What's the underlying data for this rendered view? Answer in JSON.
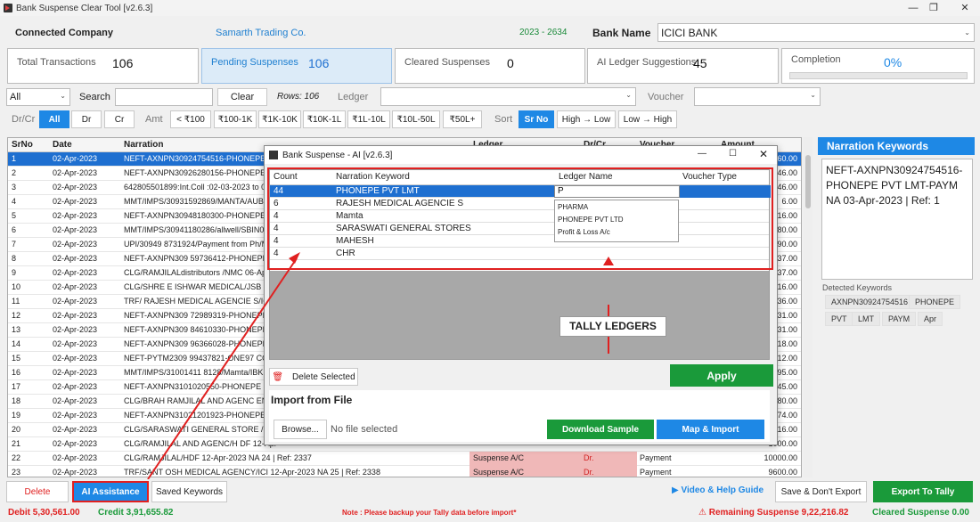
{
  "window": {
    "title": "Bank Suspense Clear Tool [v2.6.3]"
  },
  "header": {
    "company_label": "Connected Company",
    "company_value": "Samarth Trading Co.",
    "fy": "2023 - 2634",
    "bank_label": "Bank Name",
    "bank_value": "ICICI BANK"
  },
  "stats": [
    {
      "label": "Total Transactions",
      "value": "106"
    },
    {
      "label": "Pending Suspenses",
      "value": "106"
    },
    {
      "label": "Cleared Suspenses",
      "value": "0"
    },
    {
      "label": "AI Ledger Suggestions",
      "value": "45"
    },
    {
      "label": "Completion",
      "value": "0%"
    }
  ],
  "filters": {
    "all_select": "All",
    "search_label": "Search",
    "clear_label": "Clear",
    "rows_text": "Rows: 106",
    "ledger_label": "Ledger",
    "voucher_label": "Voucher",
    "drcr_label": "Dr/Cr",
    "drcr": [
      "All",
      "Dr",
      "Cr"
    ],
    "amt_label": "Amt",
    "amt": [
      "< ₹100",
      "₹100-1K",
      "₹1K-10K",
      "₹10K-1L",
      "₹1L-10L",
      "₹10L-50L",
      "₹50L+"
    ],
    "sort_label": "Sort",
    "sort": [
      "Sr No",
      "High → Low",
      "Low → High"
    ]
  },
  "grid": {
    "headers": [
      "SrNo",
      "Date",
      "Narration",
      "Ledger",
      "Dr/Cr",
      "Voucher",
      "Amount"
    ],
    "rows": [
      {
        "sr": "1",
        "date": "02-Apr-2023",
        "narr": "NEFT-AXNPN30924754516-PHONEPE PVT",
        "ledger": "",
        "drcr": "",
        "voucher": "",
        "amt": "760.00"
      },
      {
        "sr": "2",
        "date": "02-Apr-2023",
        "narr": "NEFT-AXNPN30926280156-PHONEPE PVT",
        "ledger": "",
        "drcr": "",
        "voucher": "",
        "amt": "4146.00"
      },
      {
        "sr": "3",
        "date": "02-Apr-2023",
        "narr": "642805501899:Int.Coll :02-03-2023 to 02-0",
        "ledger": "",
        "drcr": "",
        "voucher": "",
        "amt": "146.00"
      },
      {
        "sr": "4",
        "date": "02-Apr-2023",
        "narr": "MMT/IMPS/30931592869/MANTA/AUBL0",
        "ledger": "",
        "drcr": "",
        "voucher": "",
        "amt": "6.00"
      },
      {
        "sr": "5",
        "date": "02-Apr-2023",
        "narr": "NEFT-AXNPN30948180300-PHONEPE PVT",
        "ledger": "",
        "drcr": "",
        "voucher": "",
        "amt": "1116.00"
      },
      {
        "sr": "6",
        "date": "02-Apr-2023",
        "narr": "MMT/IMPS/30941180286/allwell/SBIN001",
        "ledger": "",
        "drcr": "",
        "voucher": "",
        "amt": "780.00"
      },
      {
        "sr": "7",
        "date": "02-Apr-2023",
        "narr": "UPI/30949 8731924/Payment from Ph/MA",
        "ledger": "",
        "drcr": "",
        "voucher": "",
        "amt": "1190.00"
      },
      {
        "sr": "8",
        "date": "02-Apr-2023",
        "narr": "NEFT-AXNPN309 59736412-PHONEPE PVT",
        "ledger": "",
        "drcr": "",
        "voucher": "",
        "amt": "437.00"
      },
      {
        "sr": "9",
        "date": "02-Apr-2023",
        "narr": "CLG/RAMJILALdistributors /NMC 06-Apr-2",
        "ledger": "",
        "drcr": "",
        "voucher": "",
        "amt": "437.00"
      },
      {
        "sr": "10",
        "date": "02-Apr-2023",
        "narr": "CLG/SHRE E ISHWAR MEDICAL/JSB 06-Apr",
        "ledger": "",
        "drcr": "",
        "voucher": "",
        "amt": "1016.00"
      },
      {
        "sr": "11",
        "date": "02-Apr-2023",
        "narr": "TRF/ RAJESH MEDICAL AGENCIE S/ICI 06-",
        "ledger": "",
        "drcr": "",
        "voucher": "",
        "amt": "4236.00"
      },
      {
        "sr": "12",
        "date": "02-Apr-2023",
        "narr": "NEFT-AXNPN309 72989319-PHONEPE PVT",
        "ledger": "",
        "drcr": "",
        "voucher": "",
        "amt": "631.00"
      },
      {
        "sr": "13",
        "date": "02-Apr-2023",
        "narr": "NEFT-AXNPN309 84610330-PHONEPE PVT",
        "ledger": "",
        "drcr": "",
        "voucher": "",
        "amt": "531.00"
      },
      {
        "sr": "14",
        "date": "02-Apr-2023",
        "narr": "NEFT-AXNPN309 96366028-PHONEPE PVT",
        "ledger": "",
        "drcr": "",
        "voucher": "",
        "amt": "318.00"
      },
      {
        "sr": "15",
        "date": "02-Apr-2023",
        "narr": "NEFT-PYTM2309 99437821-ONE97 COMM",
        "ledger": "",
        "drcr": "",
        "voucher": "",
        "amt": "212.00"
      },
      {
        "sr": "16",
        "date": "02-Apr-2023",
        "narr": "MMT/IMPS/31001411 8128/Mamta/IBKL0",
        "ledger": "",
        "drcr": "",
        "voucher": "",
        "amt": "495.00"
      },
      {
        "sr": "17",
        "date": "02-Apr-2023",
        "narr": "NEFT-AXNPN3101020550-PHONEPE PVT",
        "ledger": "",
        "drcr": "",
        "voucher": "",
        "amt": "945.00"
      },
      {
        "sr": "18",
        "date": "02-Apr-2023",
        "narr": "CLG/BRAH RAMJILAL AND AGENC ENTER",
        "ledger": "",
        "drcr": "",
        "voucher": "",
        "amt": "880.00"
      },
      {
        "sr": "19",
        "date": "02-Apr-2023",
        "narr": "NEFT-AXNPN31021201923-PHONEPE PVT",
        "ledger": "",
        "drcr": "",
        "voucher": "",
        "amt": "574.00"
      },
      {
        "sr": "20",
        "date": "02-Apr-2023",
        "narr": "CLG/SARASWATI GENERAL STORE /SPC 1",
        "ledger": "",
        "drcr": "",
        "voucher": "",
        "amt": "416.00"
      },
      {
        "sr": "21",
        "date": "02-Apr-2023",
        "narr": "CLG/RAMJILAL AND AGENC/H DF 12-Apr-",
        "ledger": "",
        "drcr": "",
        "voucher": "",
        "amt": "1000.00"
      },
      {
        "sr": "22",
        "date": "02-Apr-2023",
        "narr": "CLG/RAMJILAL/HDF 12-Apr-2023 NA 24 | Ref: 2337",
        "ledger": "Suspense A/C",
        "drcr": "Dr.",
        "voucher": "Payment",
        "amt": "10000.00"
      },
      {
        "sr": "23",
        "date": "02-Apr-2023",
        "narr": "TRF/SANT OSH MEDICAL AGENCY/ICI 12-Apr-2023 NA 25 | Ref: 2338",
        "ledger": "Suspense A/C",
        "drcr": "Dr.",
        "voucher": "Payment",
        "amt": "9600.00"
      }
    ]
  },
  "right_panel": {
    "title": "Narration  Keywords",
    "text": "NEFT-AXNPN30924754516-PHONEPE PVT LMT-PAYM NA 03-Apr-2023 | Ref: 1",
    "detected_label": "Detected Keywords",
    "keywords": [
      "AXNPN30924754516",
      "PHONEPE",
      "PVT",
      "LMT",
      "PAYM",
      "Apr"
    ]
  },
  "dialog": {
    "title": "Bank Suspense - AI  [v2.6.3]",
    "headers": [
      "Count",
      "Narration Keyword",
      "Ledger Name",
      "Voucher Type"
    ],
    "rows": [
      {
        "count": "44",
        "kw": "PHONEPE PVT LMT",
        "ledger": "P"
      },
      {
        "count": "6",
        "kw": "RAJESH MEDICAL AGENCIE S",
        "ledger": ""
      },
      {
        "count": "4",
        "kw": "Mamta",
        "ledger": ""
      },
      {
        "count": "4",
        "kw": "SARASWATI GENERAL STORES",
        "ledger": ""
      },
      {
        "count": "4",
        "kw": "MAHESH",
        "ledger": ""
      },
      {
        "count": "4",
        "kw": "CHR",
        "ledger": ""
      }
    ],
    "dropdown": [
      "PHARMA",
      "PHONEPE PVT LTD",
      "Profit & Loss A/c"
    ],
    "callout": "TALLY LEDGERS",
    "delete_selected": "Delete Selected",
    "apply": "Apply",
    "import_title": "Import from File",
    "browse": "Browse...",
    "no_file": "No file selected",
    "download_sample": "Download Sample",
    "map_import": "Map & Import"
  },
  "bottom": {
    "delete": "Delete",
    "ai_assist": "AI Assistance",
    "saved_kw": "Saved Keywords",
    "video_help": "Video & Help Guide",
    "save_dont_export": "Save & Don't Export",
    "export_tally": "Export To Tally",
    "debit": "Debit  5,30,561.00",
    "credit": "Credit  3,91,655.82",
    "note": "Note : Please backup your Tally data before import*",
    "remaining": "Remaining Suspense  9,22,216.82",
    "cleared": "Cleared Suspense  0.00"
  }
}
